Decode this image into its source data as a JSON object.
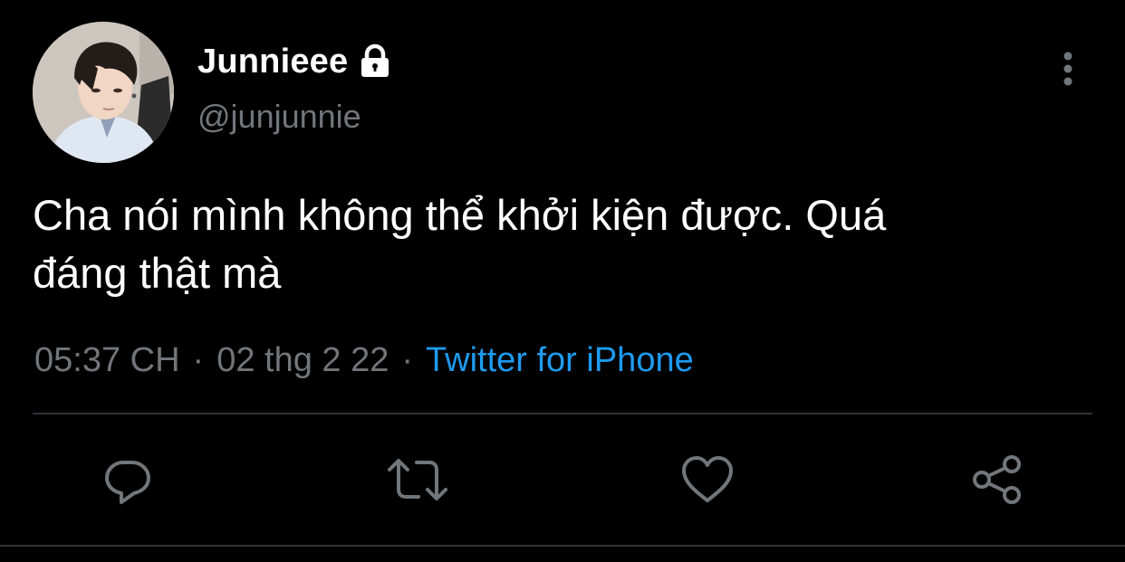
{
  "tweet": {
    "display_name": "Junnieee",
    "handle": "@junjunnie",
    "protected_icon": "lock-icon",
    "more_icon": "more-vertical-icon",
    "text_line1": "Cha nói mình không thể khởi kiện được. Quá",
    "text_line2": "đáng thật mà",
    "time": "05:37 CH",
    "date": "02 thg 2 22",
    "separator": "·",
    "source": "Twitter for iPhone"
  },
  "actions": [
    {
      "name": "reply",
      "icon": "reply-icon"
    },
    {
      "name": "retweet",
      "icon": "retweet-icon"
    },
    {
      "name": "like",
      "icon": "heart-icon"
    },
    {
      "name": "share",
      "icon": "share-icon"
    }
  ],
  "colors": {
    "background": "#000000",
    "text_primary": "#ffffff",
    "text_secondary": "#71767b",
    "accent": "#1d9bf0",
    "divider": "#2f3336"
  }
}
